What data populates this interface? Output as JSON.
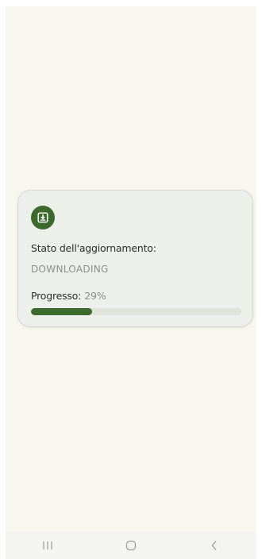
{
  "card": {
    "icon": "download-icon",
    "status_label": "Stato dell'aggiornamento:",
    "status_value": "DOWNLOADING",
    "progress_label": "Progresso:",
    "progress_value": "29%",
    "progress_fraction": 0.29,
    "accent_color": "#3b6a2c",
    "track_color": "#dfe3db"
  },
  "navbar": {
    "recent_icon": "recent-apps-icon",
    "home_icon": "home-icon",
    "back_icon": "back-icon"
  }
}
